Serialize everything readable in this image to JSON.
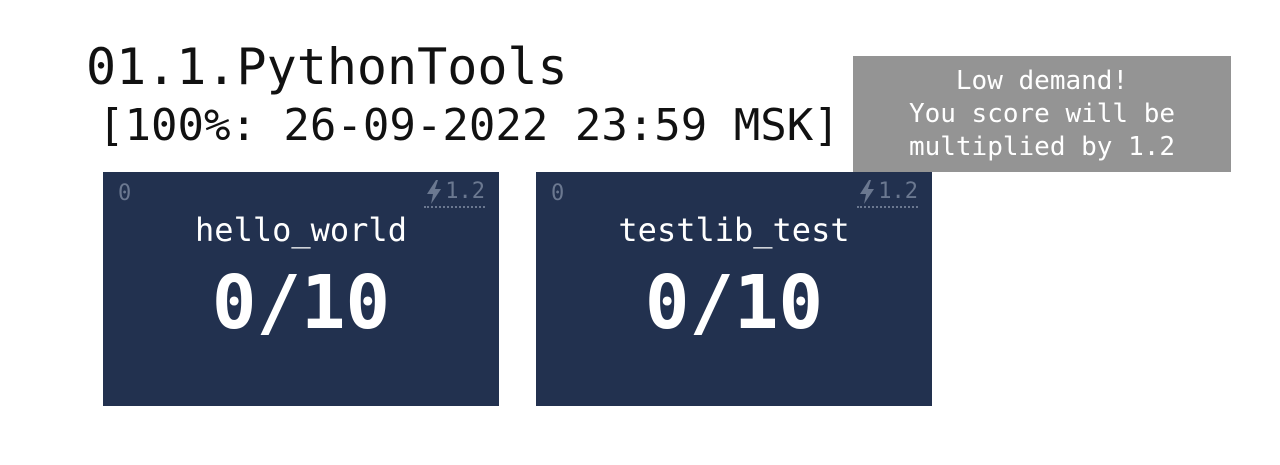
{
  "group": {
    "title": "01.1.PythonTools",
    "deadline": "[100%: 26-09-2022 23:59 MSK]"
  },
  "tasks": [
    {
      "count": "0",
      "multiplier": "1.2",
      "multiplier_icon": "lightning-bolt-icon",
      "name": "hello_world",
      "score": "0/10"
    },
    {
      "count": "0",
      "multiplier": "1.2",
      "multiplier_icon": "lightning-bolt-icon",
      "name": "testlib_test",
      "score": "0/10"
    }
  ],
  "tooltip": {
    "line1": "Low demand!",
    "line2": "You score will be",
    "line3": "multiplied by 1.2"
  },
  "colors": {
    "card_background": "#22314f",
    "card_muted_text": "#6b7890",
    "tooltip_background": "#8c8c8c"
  }
}
